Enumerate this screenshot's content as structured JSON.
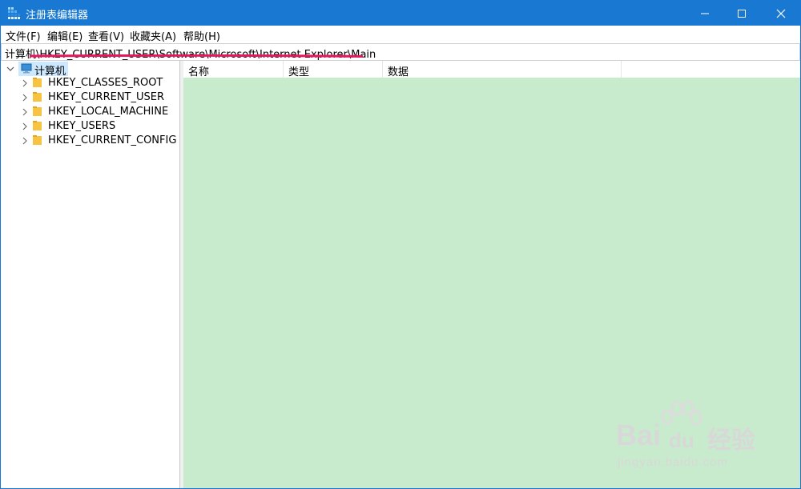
{
  "window": {
    "title": "注册表编辑器",
    "app_icon": "regedit-icon"
  },
  "menu": [
    "文件(F)",
    "编辑(E)",
    "查看(V)",
    "收藏夹(A)",
    "帮助(H)"
  ],
  "address": {
    "path": "计算机\\HKEY_CURRENT_USER\\Software\\Microsoft\\Internet Explorer\\Main"
  },
  "tree": {
    "root": "计算机",
    "children": [
      "HKEY_CLASSES_ROOT",
      "HKEY_CURRENT_USER",
      "HKEY_LOCAL_MACHINE",
      "HKEY_USERS",
      "HKEY_CURRENT_CONFIG"
    ]
  },
  "list": {
    "columns": [
      "名称",
      "类型",
      "数据"
    ]
  },
  "watermark": {
    "brand": "Bai",
    "brand_tail": "du",
    "suffix": "经验",
    "url": "jingyan.baidu.com"
  },
  "colors": {
    "titlebar": "#1979d2",
    "list_background": "#c7ebcc",
    "underline": "#e8175d",
    "selection": "#cce8ff"
  }
}
